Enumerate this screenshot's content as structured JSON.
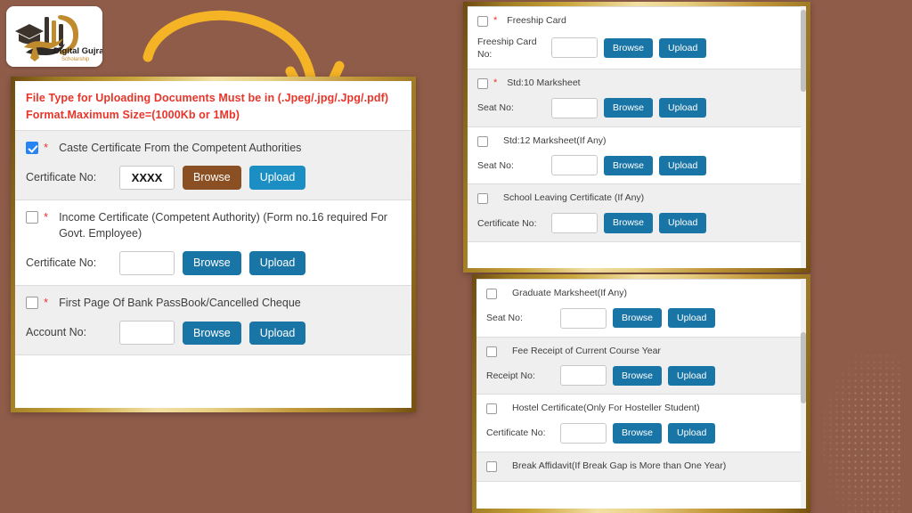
{
  "background_color": "#8f5c49",
  "logo": {
    "name": "digital-gujrat-logo",
    "title": "Digital Gujrat",
    "subtitle": "Scholarship"
  },
  "arrow": {
    "name": "curved-down-arrow",
    "color": "#f5b326"
  },
  "notice": {
    "line1": "File Type for Uploading Documents Must be in (.Jpeg/.jpg/.Jpg/.pdf)",
    "line2": "Format.Maximum Size=(1000Kb or 1Mb)",
    "color": "#e8352a"
  },
  "buttons": {
    "browse": "Browse",
    "upload": "Upload"
  },
  "colors": {
    "button_blue": "#1a75a7",
    "button_blue_bright": "#1b8fc4",
    "button_brown_hover": "#8a4f22",
    "checkbox_checked": "#2684f3",
    "required_star": "#e8352a",
    "panel_gold": "#c9a53a"
  },
  "panel_main": {
    "name": "upload-documents-panel-main",
    "rows": [
      {
        "label": "Caste Certificate From the Competent Authorities",
        "required": true,
        "checked": true,
        "field_label": "Certificate No:",
        "field_value": "XXXX",
        "browse_style": "brown",
        "upload_style": "bright",
        "shade": true
      },
      {
        "label": "Income Certificate (Competent Authority) (Form no.16 required For Govt. Employee)",
        "required": true,
        "checked": false,
        "field_label": "Certificate No:",
        "field_value": "",
        "browse_style": "blue",
        "upload_style": "blue",
        "shade": false
      },
      {
        "label": "First Page Of Bank PassBook/Cancelled Cheque",
        "required": true,
        "checked": false,
        "field_label": "Account No:",
        "field_value": "",
        "browse_style": "blue",
        "upload_style": "blue",
        "shade": true
      }
    ]
  },
  "panel_top_right": {
    "name": "upload-documents-panel-top-right",
    "rows": [
      {
        "label": "Freeship Card",
        "required": true,
        "checked": false,
        "field_label": "Freeship Card No:",
        "field_value": "",
        "browse_style": "blue",
        "upload_style": "blue",
        "shade": false
      },
      {
        "label": "Std:10 Marksheet",
        "required": true,
        "checked": false,
        "field_label": "Seat No:",
        "field_value": "",
        "browse_style": "blue",
        "upload_style": "blue",
        "shade": true
      },
      {
        "label": "Std:12 Marksheet(If Any)",
        "required": false,
        "checked": false,
        "field_label": "Seat No:",
        "field_value": "",
        "browse_style": "blue",
        "upload_style": "blue",
        "shade": false
      },
      {
        "label": "School Leaving Certificate (If Any)",
        "required": false,
        "checked": false,
        "field_label": "Certificate No:",
        "field_value": "",
        "browse_style": "blue",
        "upload_style": "blue",
        "shade": true
      }
    ]
  },
  "panel_bottom_right": {
    "name": "upload-documents-panel-bottom-right",
    "rows": [
      {
        "label": "Graduate Marksheet(If Any)",
        "required": false,
        "checked": false,
        "field_label": "Seat No:",
        "field_value": "",
        "browse_style": "blue",
        "upload_style": "blue",
        "shade": false
      },
      {
        "label": "Fee Receipt of Current Course Year",
        "required": false,
        "checked": false,
        "field_label": "Receipt No:",
        "field_value": "",
        "browse_style": "blue",
        "upload_style": "blue",
        "shade": true
      },
      {
        "label": "Hostel Certificate(Only For Hosteller Student)",
        "required": false,
        "checked": false,
        "field_label": "Certificate No:",
        "field_value": "",
        "browse_style": "blue",
        "upload_style": "blue",
        "shade": false
      },
      {
        "label": "Break Affidavit(If Break Gap is More than One Year)",
        "required": false,
        "checked": false,
        "field_label": "",
        "field_value": "",
        "browse_style": "blue",
        "upload_style": "blue",
        "shade": true
      }
    ]
  }
}
